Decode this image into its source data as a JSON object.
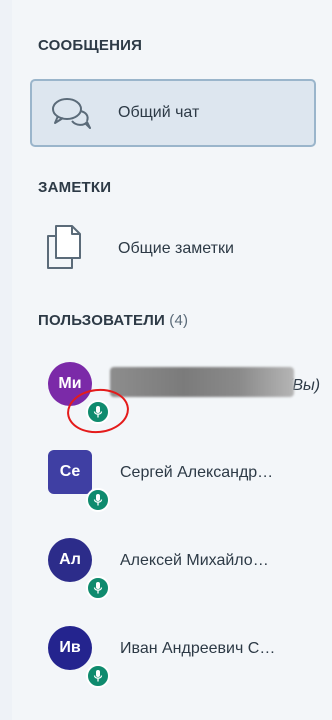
{
  "sections": {
    "messages_title": "СООБЩЕНИЯ",
    "notes_title": "ЗАМЕТКИ",
    "users_title": "ПОЛЬЗОВАТЕЛИ",
    "users_count": "(4)"
  },
  "chat": {
    "label": "Общий чат",
    "icon": "chat-bubbles-icon"
  },
  "notes": {
    "label": "Общие заметки",
    "icon": "document-copy-icon"
  },
  "users": [
    {
      "initials": "Ми",
      "name": "",
      "you_label": "(Вы)",
      "avatar_color": "#7b2aa8",
      "shape": "round",
      "mic": true
    },
    {
      "initials": "Се",
      "name": "Сергей Александр…",
      "avatar_color": "#3f3fa3",
      "shape": "square",
      "mic": true
    },
    {
      "initials": "Ал",
      "name": "Алексей Михайло…",
      "avatar_color": "#2c2c8a",
      "shape": "round",
      "mic": true
    },
    {
      "initials": "Ив",
      "name": "Иван Андреевич С…",
      "avatar_color": "#24248e",
      "shape": "round",
      "mic": true
    }
  ],
  "colors": {
    "mic_badge": "#0f8b6e",
    "annotation_circle": "#e41b1b"
  }
}
